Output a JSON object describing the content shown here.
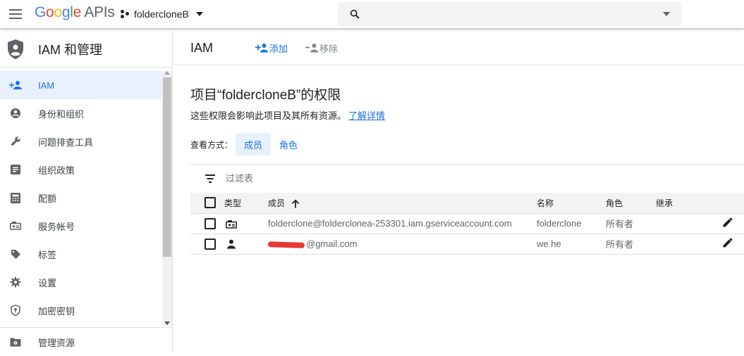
{
  "topbar": {
    "logo_google": [
      "G",
      "o",
      "o",
      "g",
      "l",
      "e"
    ],
    "logo_apis": "APIs",
    "project_name": "foldercloneB",
    "search_value": ""
  },
  "sidebar": {
    "title": "IAM 和管理",
    "items": [
      {
        "label": "IAM",
        "icon": "person-add-icon",
        "active": true
      },
      {
        "label": "身份和组织",
        "icon": "account-circle-icon"
      },
      {
        "label": "问题排查工具",
        "icon": "wrench-icon"
      },
      {
        "label": "组织政策",
        "icon": "article-icon"
      },
      {
        "label": "配额",
        "icon": "calculator-icon"
      },
      {
        "label": "服务帐号",
        "icon": "service-account-icon"
      },
      {
        "label": "标签",
        "icon": "tag-icon"
      },
      {
        "label": "设置",
        "icon": "gear-icon"
      },
      {
        "label": "加密密钥",
        "icon": "shield-key-icon"
      }
    ],
    "bottom_item": {
      "label": "管理资源",
      "icon": "folder-settings-icon"
    }
  },
  "actionbar": {
    "title": "IAM",
    "add_label": "添加",
    "remove_label": "移除"
  },
  "main": {
    "heading": "项目“foldercloneB”的权限",
    "description": "这些权限会影响此项目及其所有资源。",
    "learn_more": "了解详情",
    "view_by_label": "查看方式：",
    "tabs": [
      "成员",
      "角色"
    ],
    "filter_placeholder": "过滤表"
  },
  "table": {
    "headers": {
      "type": "类型",
      "member": "成员",
      "name": "名称",
      "role": "角色",
      "inherit": "继承"
    },
    "rows": [
      {
        "type_icon": "service-account-icon",
        "member": "folderclone@folderclonea-253301.iam.gserviceaccount.com",
        "name": "folderclone",
        "role": "所有者"
      },
      {
        "type_icon": "person-icon",
        "member": "@gmail.com",
        "member_redacted": true,
        "name": "we he",
        "role": "所有者"
      }
    ]
  },
  "colors": {
    "accent": "#1a73e8",
    "active_bg": "#e8f0fe",
    "redaction": "#e53935"
  }
}
